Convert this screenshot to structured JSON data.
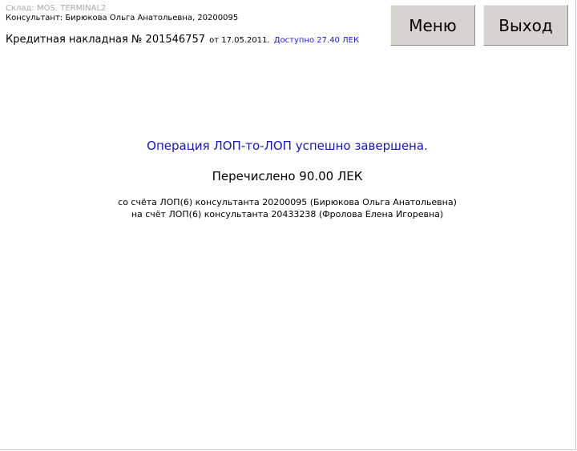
{
  "header": {
    "warehouse": "Склад: MOS. TERMINAL2",
    "consultant": "Консультант: Бирюкова Ольга Анатольевна, 20200095",
    "invoice_title": "Кредитная накладная № 201546757",
    "invoice_date": "от 17.05.2011.",
    "invoice_available": "Доступно 27.40 ЛЕК"
  },
  "toolbar": {
    "menu_label": "Меню",
    "exit_label": "Выход"
  },
  "result": {
    "success_message": "Операция ЛОП-то-ЛОП успешно завершена.",
    "transferred": "Перечислено 90.00 ЛЕК",
    "from_account": "со счёта ЛОП(6) консультанта 20200095 (Бирюкова Ольга Анатольевна)",
    "to_account": "на счёт ЛОП(6) консультанта 20433238 (Фролова Елена Игоревна)"
  },
  "colors": {
    "accent_blue": "#1414d2",
    "button_face": "#d7d4cf",
    "muted_gray": "#a8a8a8"
  }
}
